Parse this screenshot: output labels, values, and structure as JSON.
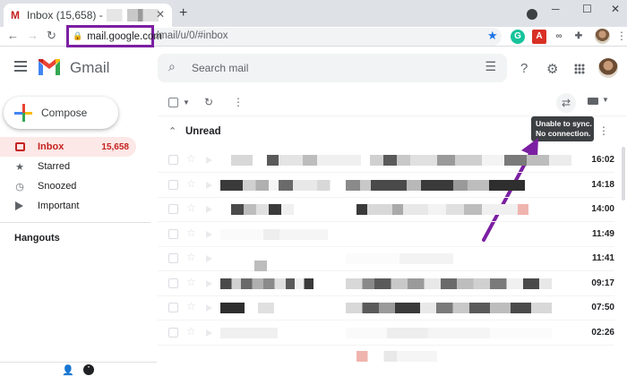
{
  "browser": {
    "tab": {
      "favicon": "M",
      "title": "Inbox (15,658) -",
      "close_icon": "close-icon"
    },
    "new_tab_symbol": "+",
    "window_controls": {
      "minimize": "─",
      "maximize": "☐",
      "close": "✕"
    },
    "address": {
      "host": "mail.google.com",
      "path": "/mail/u/0/#inbox"
    },
    "extensions": [
      {
        "name": "grammarly",
        "glyph": "G",
        "color": "#15c39a"
      },
      {
        "name": "pdf",
        "glyph": "A",
        "color": "#d93025"
      },
      {
        "name": "cloud",
        "glyph": "∞",
        "color": "#5f6368"
      },
      {
        "name": "puzzle",
        "glyph": "✚",
        "color": "#5f6368"
      }
    ]
  },
  "header": {
    "app_name": "Gmail",
    "search_placeholder": "Search mail",
    "icons": [
      "menu-icon",
      "search-icon",
      "tune-icon",
      "help-icon",
      "settings-icon",
      "apps-icon"
    ]
  },
  "sidebar": {
    "compose_label": "Compose",
    "items": [
      {
        "label": "Inbox",
        "count": "15,658",
        "icon": "inbox-icon",
        "active": true
      },
      {
        "label": "Starred",
        "count": "",
        "icon": "star-icon",
        "active": false
      },
      {
        "label": "Snoozed",
        "count": "",
        "icon": "clock-icon",
        "active": false
      },
      {
        "label": "Important",
        "count": "",
        "icon": "important-icon",
        "active": false
      }
    ],
    "hangouts_label": "Hangouts"
  },
  "toolbar": {
    "tooltip_line1": "Unable to sync.",
    "tooltip_line2": "No connection."
  },
  "section": {
    "title": "Unread"
  },
  "emails": [
    {
      "time": "16:02"
    },
    {
      "time": "14:18"
    },
    {
      "time": "14:00"
    },
    {
      "time": "11:49"
    },
    {
      "time": "11:41"
    },
    {
      "time": "09:17"
    },
    {
      "time": "07:50"
    },
    {
      "time": "02:26"
    }
  ],
  "colors": {
    "accent_purple": "#7b1fa2",
    "inbox_red": "#c5221f",
    "tooltip_bg": "#3c4043"
  }
}
